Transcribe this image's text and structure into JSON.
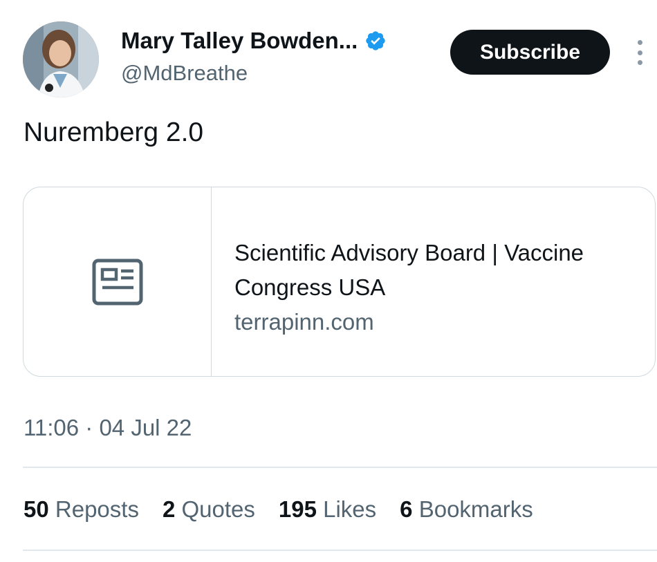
{
  "author": {
    "display_name": "Mary Talley Bowden...",
    "handle": "@MdBreathe",
    "verified_icon": "verified-badge-icon",
    "avatar": "avatar-photo"
  },
  "header": {
    "subscribe_label": "Subscribe",
    "more_icon": "more-options-icon"
  },
  "tweet": {
    "text": "Nuremberg 2.0",
    "timestamp": "11:06 · 04 Jul 22"
  },
  "link_card": {
    "icon": "article-icon",
    "title": "Scientific Advisory Board | Vaccine Congress USA",
    "domain": "terrapinn.com"
  },
  "stats": [
    {
      "count": "50",
      "label": "Reposts"
    },
    {
      "count": "2",
      "label": "Quotes"
    },
    {
      "count": "195",
      "label": "Likes"
    },
    {
      "count": "6",
      "label": "Bookmarks"
    }
  ],
  "colors": {
    "text_primary": "#0f1419",
    "text_secondary": "#536471",
    "verified_blue": "#1d9bf0",
    "border": "#cfd9de",
    "button_bg": "#0f1419"
  }
}
